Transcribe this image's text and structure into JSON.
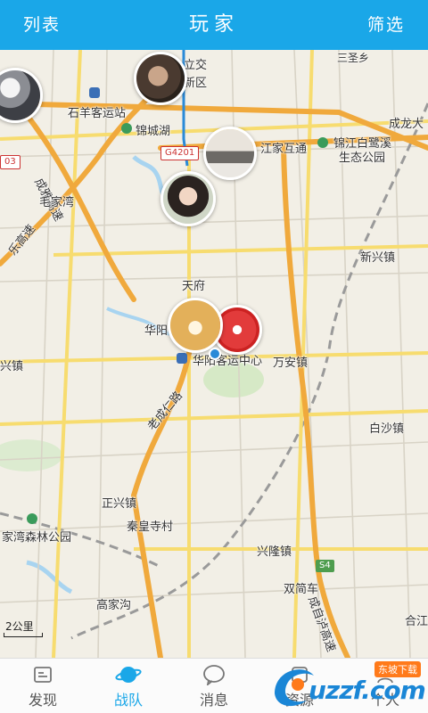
{
  "header": {
    "left_label": "列表",
    "title": "玩家",
    "right_label": "筛选"
  },
  "map": {
    "labels": {
      "lijiao": "立交",
      "xinqu": "新区",
      "sanshengxiang": "三圣乡",
      "shiyang_bus": "石羊客运站",
      "jinchenghu": "锦城湖",
      "chenglongda": "成龙大",
      "jiangjiahutong": "江家互通",
      "jinjiang_park": "锦江白鹭溪",
      "jinjiang_park2": "生态公园",
      "chengya_hwy": "成雅高速",
      "maojiawan": "毛家湾",
      "chengle_hwy": "乐高速",
      "xinxingzhen": "新兴镇",
      "tianfu": "天府",
      "huayang": "华阳",
      "huayang_bus": "华阳客运中心",
      "wananzhen": "万安镇",
      "xingzhen_left": "兴镇",
      "baishazhen": "白沙镇",
      "laocheng_road": "老成仁路",
      "zhengxingzhen": "正兴镇",
      "qinhuang_temple": "秦皇寺村",
      "forest_park": "家湾森林公园",
      "xinglongzhen": "兴隆镇",
      "shuangtongche": "双简车",
      "gaojiagou": "高家沟",
      "hejiang": "合江",
      "chengzi_hwy": "成自泸高速",
      "road_03": "03",
      "road_g4201": "G4201",
      "road_s4": "S4"
    },
    "scale": "2公里"
  },
  "tabs": [
    {
      "label": "发现",
      "icon": "discover-icon"
    },
    {
      "label": "战队",
      "icon": "team-planet-icon"
    },
    {
      "label": "消息",
      "icon": "message-icon"
    },
    {
      "label": "资源",
      "icon": "resource-icon"
    },
    {
      "label": "个人",
      "icon": "person-icon"
    }
  ],
  "active_tab": "战队",
  "watermark": {
    "top": "东坡下载",
    "main": "uzzf.com"
  },
  "colors": {
    "accent": "#1aa7e8",
    "highway": "#f0a93c",
    "major_road": "#f7dc6f",
    "water": "#a8d4f0"
  }
}
